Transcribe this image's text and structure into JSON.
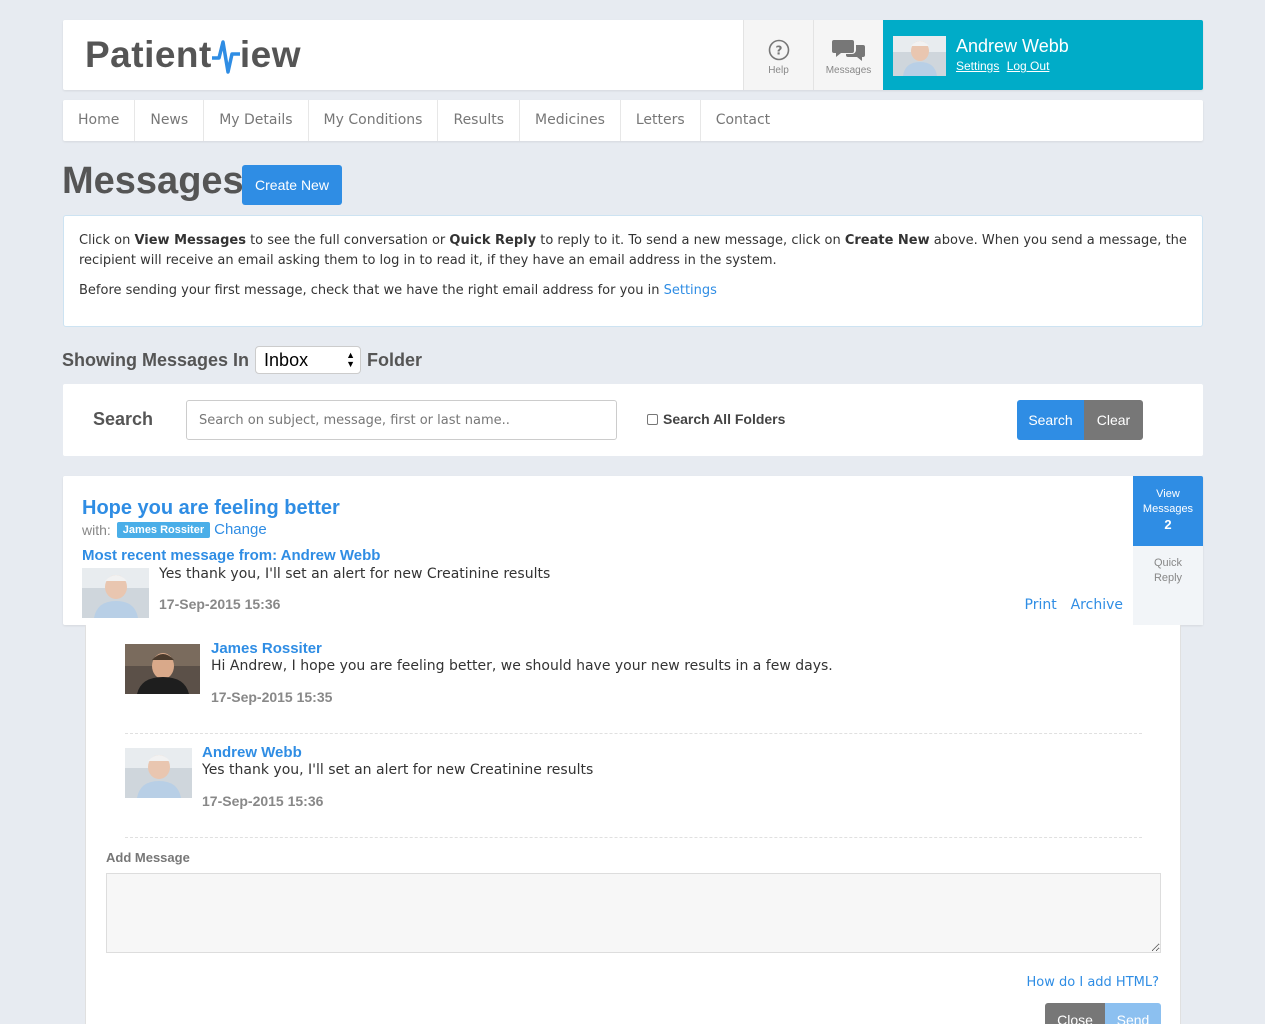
{
  "header": {
    "logo_text_left": "Patient",
    "logo_text_right": "iew",
    "help_label": "Help",
    "messages_label": "Messages",
    "user_name": "Andrew Webb",
    "settings_link": "Settings",
    "logout_link": "Log Out",
    "brand_color": "#00acc8"
  },
  "nav": {
    "items": [
      "Home",
      "News",
      "My Details",
      "My Conditions",
      "Results",
      "Medicines",
      "Letters",
      "Contact"
    ]
  },
  "page": {
    "title": "Messages",
    "create_button": "Create New"
  },
  "info": {
    "p1_a": "Click on ",
    "p1_b": "View Messages",
    "p1_c": " to see the full conversation or ",
    "p1_d": "Quick Reply",
    "p1_e": " to reply to it. To send a new message, click on ",
    "p1_f": "Create New",
    "p1_g": " above. When you send a message, the recipient will receive an email asking them to log in to read it, if they have an email address in the system.",
    "p2_a": "Before sending your first message, check that we have the right email address for you in ",
    "p2_link": "Settings"
  },
  "folder": {
    "prefix": "Showing Messages In",
    "selected": "Inbox",
    "suffix": "Folder"
  },
  "search": {
    "label": "Search",
    "placeholder": "Search on subject, message, first or last name..",
    "all_folders_label": "Search All Folders",
    "search_button": "Search",
    "clear_button": "Clear"
  },
  "message": {
    "subject": "Hope you are feeling better",
    "with_label": "with:",
    "with_name": "James Rossiter",
    "change_link": "Change",
    "recent_label": "Most recent message from: Andrew Webb",
    "recent_text": "Yes thank you, I'll set an alert for new Creatinine results",
    "recent_date": "17-Sep-2015 15:36",
    "print_link": "Print",
    "archive_link": "Archive",
    "view_messages_line1": "View",
    "view_messages_line2": "Messages",
    "view_messages_count": "2",
    "quick_reply_line1": "Quick",
    "quick_reply_line2": "Reply"
  },
  "conversation": {
    "items": [
      {
        "name": "James Rossiter",
        "text": "Hi Andrew, I hope you are feeling better, we should have your new results in a few days.",
        "date": "17-Sep-2015 15:35"
      },
      {
        "name": "Andrew Webb",
        "text": "Yes thank you, I'll set an alert for new Creatinine results",
        "date": "17-Sep-2015 15:36"
      }
    ],
    "add_label": "Add Message",
    "html_link": "How do I add HTML?",
    "close_button": "Close",
    "send_button": "Send"
  }
}
